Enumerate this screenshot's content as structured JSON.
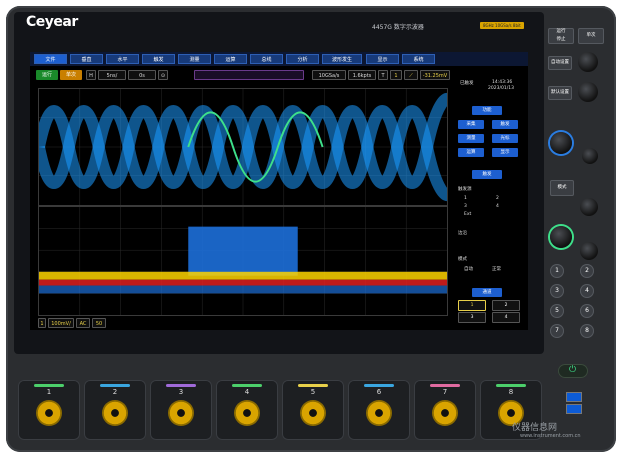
{
  "brand": "Ceyear",
  "model": "4457G 数字示波器",
  "badge": "8GHz 10GSa/s 8bit",
  "menu": [
    "文件",
    "垂直",
    "水平",
    "触发",
    "测量",
    "运算",
    "总线",
    "分析",
    "波形发生",
    "显示",
    "系统"
  ],
  "toolbar": {
    "run": "运行",
    "single": "单次",
    "h": "H",
    "timebase": "5ns/",
    "offset": "0s",
    "rate": "10GSa/s",
    "points": "1.6kpts",
    "t": "T",
    "ch": "1",
    "level": "-31.25mV"
  },
  "side": {
    "status": "已触发",
    "time": "14:43:36",
    "date": "2023/01/13",
    "func": "功能",
    "f": [
      "采集",
      "触发",
      "测量",
      "光标",
      "运算",
      "显示"
    ],
    "trig": "触发",
    "trig_source": "触发源",
    "src": [
      "1",
      "2",
      "3",
      "4",
      "Ext"
    ],
    "edge": "边沿",
    "mode": "模式",
    "auto": "自动",
    "normal": "正常",
    "channel": "通道",
    "ch": [
      "1",
      "2",
      "3",
      "4"
    ]
  },
  "footer": {
    "ch": "1",
    "scale": "100mV/",
    "coupling": "AC",
    "imp": "50"
  },
  "panel": {
    "run_stop": "运行\n停止",
    "single": "单次",
    "autoset": "自动设置",
    "default": "默认设置",
    "mode": "模式",
    "nums": [
      "1",
      "2",
      "3",
      "4",
      "5",
      "6",
      "7",
      "8"
    ]
  },
  "bnc": [
    "1",
    "2",
    "3",
    "4",
    "5",
    "6",
    "7",
    "8"
  ],
  "bnc_colors": [
    "#4ccf6b",
    "#3aa6e0",
    "#a06ad9",
    "#4ccf6b",
    "#e8d04a",
    "#3aa6e0",
    "#e06aa0",
    "#4ccf6b"
  ],
  "watermark": "仪器信息网",
  "watermark2": "www.instrument.com.cn"
}
